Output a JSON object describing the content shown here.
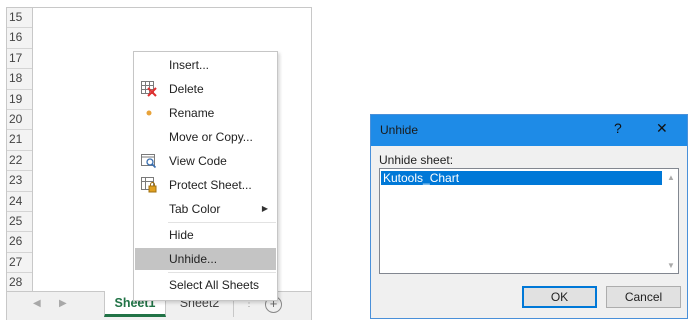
{
  "sheet": {
    "rows": [
      "15",
      "16",
      "17",
      "18",
      "19",
      "20",
      "21",
      "22",
      "23",
      "24",
      "25",
      "26",
      "27",
      "28"
    ],
    "tabs": [
      "Sheet1",
      "Sheet2"
    ],
    "add_sheet_glyph": "+"
  },
  "context_menu": {
    "items": [
      {
        "label": "Insert...",
        "icon": ""
      },
      {
        "label": "Delete",
        "icon": "delete-sheet-icon"
      },
      {
        "label": "Rename",
        "icon": "bullet-dot-icon"
      },
      {
        "label": "Move or Copy...",
        "icon": ""
      },
      {
        "label": "View Code",
        "icon": "view-code-icon"
      },
      {
        "label": "Protect Sheet...",
        "icon": "protect-sheet-icon"
      },
      {
        "label": "Tab Color",
        "icon": "",
        "submenu": true
      },
      {
        "label": "Hide",
        "icon": ""
      },
      {
        "label": "Unhide...",
        "icon": "",
        "highlighted": true
      },
      {
        "label": "Select All Sheets",
        "icon": ""
      }
    ]
  },
  "dialog": {
    "title": "Unhide",
    "help_glyph": "?",
    "close_glyph": "✕",
    "label": "Unhide sheet:",
    "sheets": [
      "Kutools_Chart"
    ],
    "ok_label": "OK",
    "cancel_label": "Cancel"
  },
  "colors": {
    "accent_green": "#217346",
    "titlebar_blue": "#1e8be7",
    "selection_blue": "#0078d7",
    "menu_highlight": "#c4c4c4"
  }
}
